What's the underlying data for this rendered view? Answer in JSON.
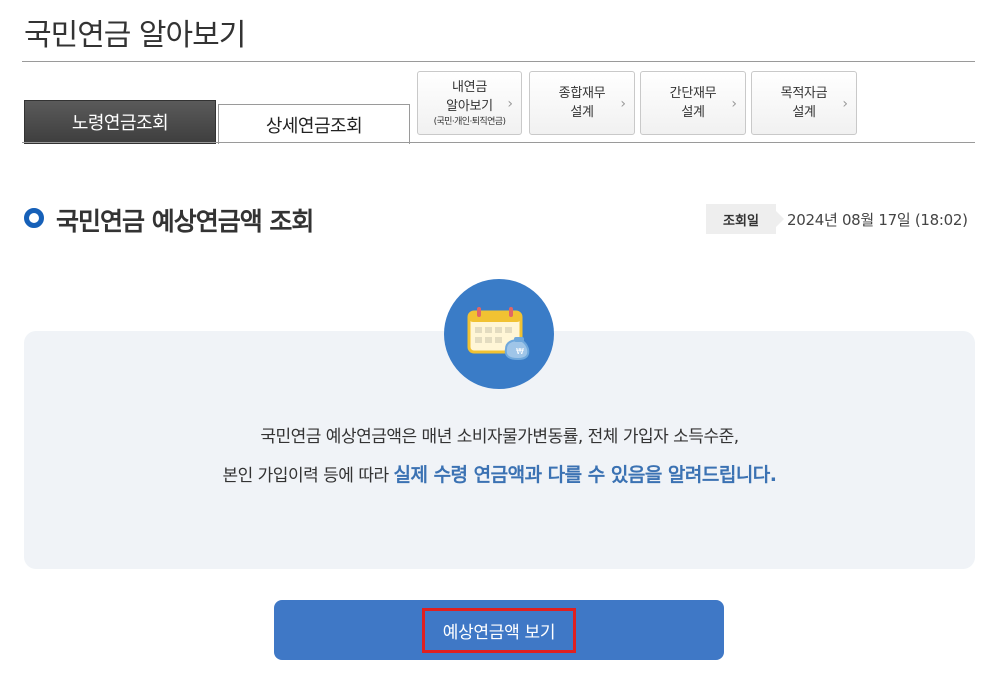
{
  "page": {
    "title": "국민연금 알아보기"
  },
  "tabs": [
    {
      "label": "노령연금조회",
      "active": true
    },
    {
      "label": "상세연금조회",
      "active": false
    }
  ],
  "services": [
    {
      "line1": "내연금",
      "line2": "알아보기",
      "sub": "(국민·개인·퇴직연금)"
    },
    {
      "line1": "종합재무",
      "line2": "설계"
    },
    {
      "line1": "간단재무",
      "line2": "설계"
    },
    {
      "line1": "목적자금",
      "line2": "설계"
    }
  ],
  "section": {
    "title": "국민연금 예상연금액 조회"
  },
  "query_date": {
    "label": "조회일",
    "value": "2024년 08월 17일 (18:02)"
  },
  "notice": {
    "icon": "calendar-money-icon",
    "line1": "국민연금 예상연금액은 매년 소비자물가변동률, 전체 가입자 소득수준,",
    "line2_prefix": "본인 가입이력 등에 따라 ",
    "line2_highlight": "실제 수령 연금액과 다를 수 있음을 알려드립니다."
  },
  "action": {
    "label": "예상연금액 보기"
  },
  "colors": {
    "accent_blue": "#3f78c6",
    "highlight_blue": "#3b72b3",
    "icon_circle": "#3a7cc7",
    "focus_red": "#e02020"
  }
}
